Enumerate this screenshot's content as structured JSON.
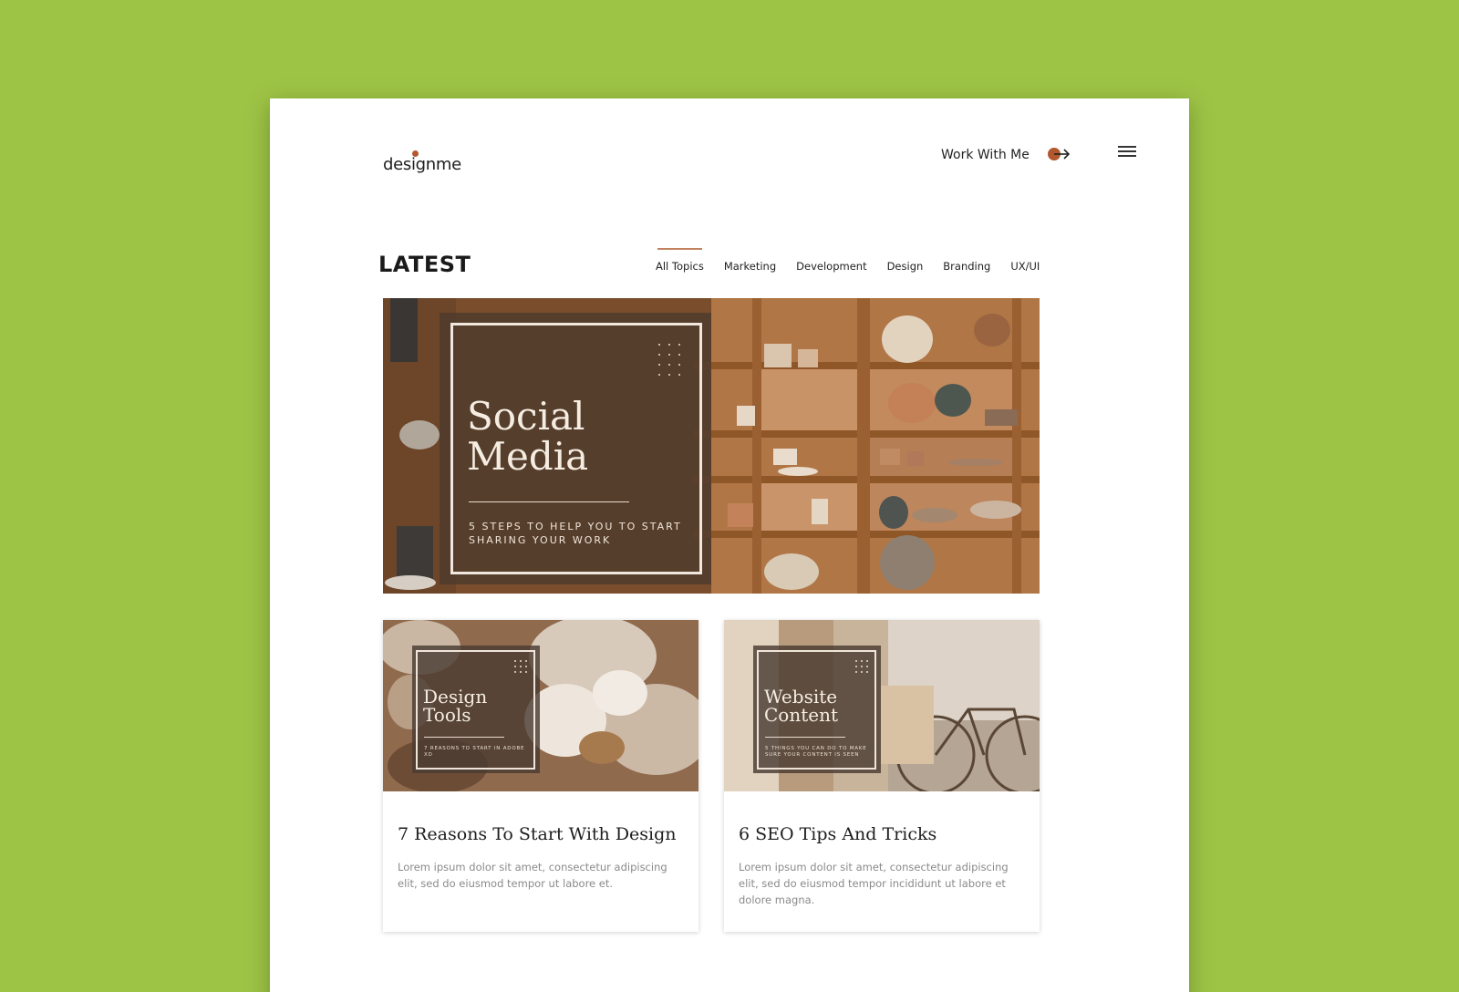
{
  "brand": {
    "logo": "designme"
  },
  "header": {
    "work_link": "Work With Me",
    "arrow_icon": "arrow-right-icon",
    "menu_icon": "hamburger-menu-icon"
  },
  "latest": {
    "title": "LATEST",
    "tabs": [
      {
        "label": "All Topics",
        "active": true
      },
      {
        "label": "Marketing",
        "active": false
      },
      {
        "label": "Development",
        "active": false
      },
      {
        "label": "Design",
        "active": false
      },
      {
        "label": "Branding",
        "active": false
      },
      {
        "label": "UX/UI",
        "active": false
      }
    ]
  },
  "hero": {
    "title_line1": "Social",
    "title_line2": "Media",
    "subtitle_line1": "5 STEPS TO HELP YOU TO START",
    "subtitle_line2": "SHARING YOUR WORK"
  },
  "cards": [
    {
      "image_title_line1": "Design",
      "image_title_line2": "Tools",
      "image_sub": "7 REASONS TO START IN ADOBE XD",
      "title": "7 Reasons To Start With Design",
      "desc": "Lorem ipsum dolor sit amet, consectetur adipiscing elit, sed do eiusmod tempor ut labore et."
    },
    {
      "image_title_line1": "Website",
      "image_title_line2": "Content",
      "image_sub": "5 THINGS YOU CAN DO TO MAKE SURE YOUR CONTENT IS SEEN",
      "title": "6 SEO Tips And Tricks",
      "desc": "Lorem ipsum dolor sit amet, consectetur adipiscing elit, sed do eiusmod tempor incididunt ut labore et dolore magna."
    }
  ],
  "colors": {
    "background": "#9ec446",
    "accent": "#b2582e",
    "tab_underline": "#c28460"
  }
}
